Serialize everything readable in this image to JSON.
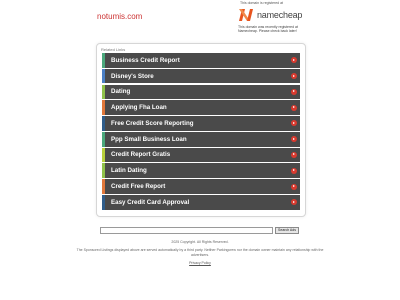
{
  "domain": "notumis.com",
  "registrar": {
    "caption": "This domain is registered at",
    "name": "namecheap",
    "note": "This domain was recently registered at Namecheap. Please check back later!"
  },
  "panel": {
    "heading": "Related Links",
    "links": [
      {
        "label": "Business Credit Report",
        "accent": "#4aa87c"
      },
      {
        "label": "Disney's Store",
        "accent": "#4a7fc4"
      },
      {
        "label": "Dating",
        "accent": "#8fc24a"
      },
      {
        "label": "Applying Fha Loan",
        "accent": "#e0773a"
      },
      {
        "label": "Free Credit Score Reporting",
        "accent": "#2f5d8a"
      },
      {
        "label": "Ppp Small Business Loan",
        "accent": "#4aa87c"
      },
      {
        "label": "Credit Report Gratis",
        "accent": "#b8d03c"
      },
      {
        "label": "Latin Dating",
        "accent": "#8fc24a"
      },
      {
        "label": "Credit Free Report",
        "accent": "#e0773a"
      },
      {
        "label": "Easy Credit Card Approval",
        "accent": "#2f5d8a"
      }
    ]
  },
  "search": {
    "placeholder": "",
    "button": "Search Ads"
  },
  "footer": {
    "copyright": "2025 Copyright. All Rights Reserved.",
    "disclaimer": "The Sponsored Listings displayed above are served automatically by a third party. Neither Parkingcrew nor the domain owner maintain any relationship with the advertisers.",
    "privacy": "Privacy Policy"
  },
  "colors": {
    "domain": "#cc3333",
    "row_bg": "#4a4a4a",
    "arrow": "#d93a2f",
    "brand": "#e8541e"
  },
  "icons": {
    "brand": "namecheap-logo-icon",
    "row": "arrow-right-icon"
  }
}
